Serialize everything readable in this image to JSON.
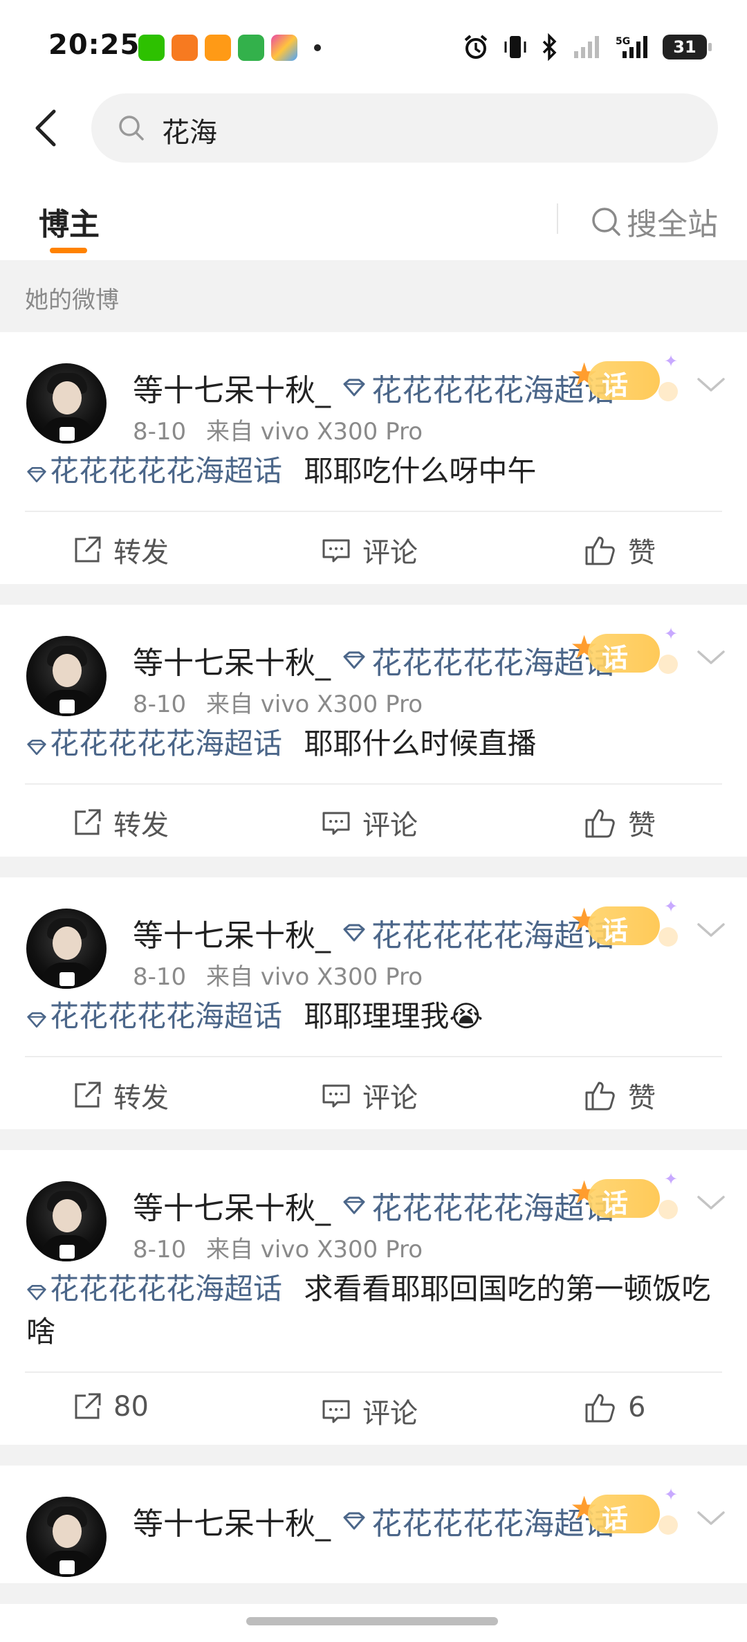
{
  "status_bar": {
    "time": "20:25",
    "app_icons": [
      {
        "name": "wechat-icon",
        "color": "#2dc100"
      },
      {
        "name": "app-orange-icon",
        "color": "#f77a20"
      },
      {
        "name": "app-orange2-icon",
        "color": "#ff9a16"
      },
      {
        "name": "app-green-icon",
        "color": "#33b14b"
      },
      {
        "name": "app-colorful-icon",
        "color": "#e94aa5"
      }
    ],
    "system_icons": [
      "alarm-icon",
      "vibrate-icon",
      "bluetooth-icon",
      "signal-icon",
      "5g-signal-icon"
    ],
    "battery_level": "31"
  },
  "search": {
    "query": "花海"
  },
  "tabs": {
    "blogger": "博主",
    "search_all": "搜全站"
  },
  "section": {
    "label": "她的微博"
  },
  "accent_color": "#ff8200",
  "link_color": "#4b6689",
  "posts": [
    {
      "username": "等十七呆十秋_",
      "topic": "花花花花花海超话",
      "badge": "话",
      "date": "8-10",
      "source": "来自",
      "device": "vivo X300 Pro",
      "tag": "花花花花花海超话",
      "text": "耶耶吃什么呀中午",
      "repost": "转发",
      "comment": "评论",
      "like": "赞"
    },
    {
      "username": "等十七呆十秋_",
      "topic": "花花花花花海超话",
      "badge": "话",
      "date": "8-10",
      "source": "来自",
      "device": "vivo X300 Pro",
      "tag": "花花花花花海超话",
      "text": "耶耶什么时候直播",
      "repost": "转发",
      "comment": "评论",
      "like": "赞"
    },
    {
      "username": "等十七呆十秋_",
      "topic": "花花花花花海超话",
      "badge": "话",
      "date": "8-10",
      "source": "来自",
      "device": "vivo X300 Pro",
      "tag": "花花花花花海超话",
      "text": "耶耶理理我😭",
      "repost": "转发",
      "comment": "评论",
      "like": "赞"
    },
    {
      "username": "等十七呆十秋_",
      "topic": "花花花花花海超话",
      "badge": "话",
      "date": "8-10",
      "source": "来自",
      "device": "vivo X300 Pro",
      "tag": "花花花花花海超话",
      "text": "求看看耶耶回国吃的第一顿饭吃啥",
      "repost": "80",
      "comment": "评论",
      "like": "6"
    },
    {
      "username": "等十七呆十秋_",
      "topic": "花花花花花海超话",
      "badge": "话",
      "date": "",
      "source": "",
      "device": "",
      "tag": "",
      "text": "",
      "repost": "",
      "comment": "",
      "like": ""
    }
  ]
}
